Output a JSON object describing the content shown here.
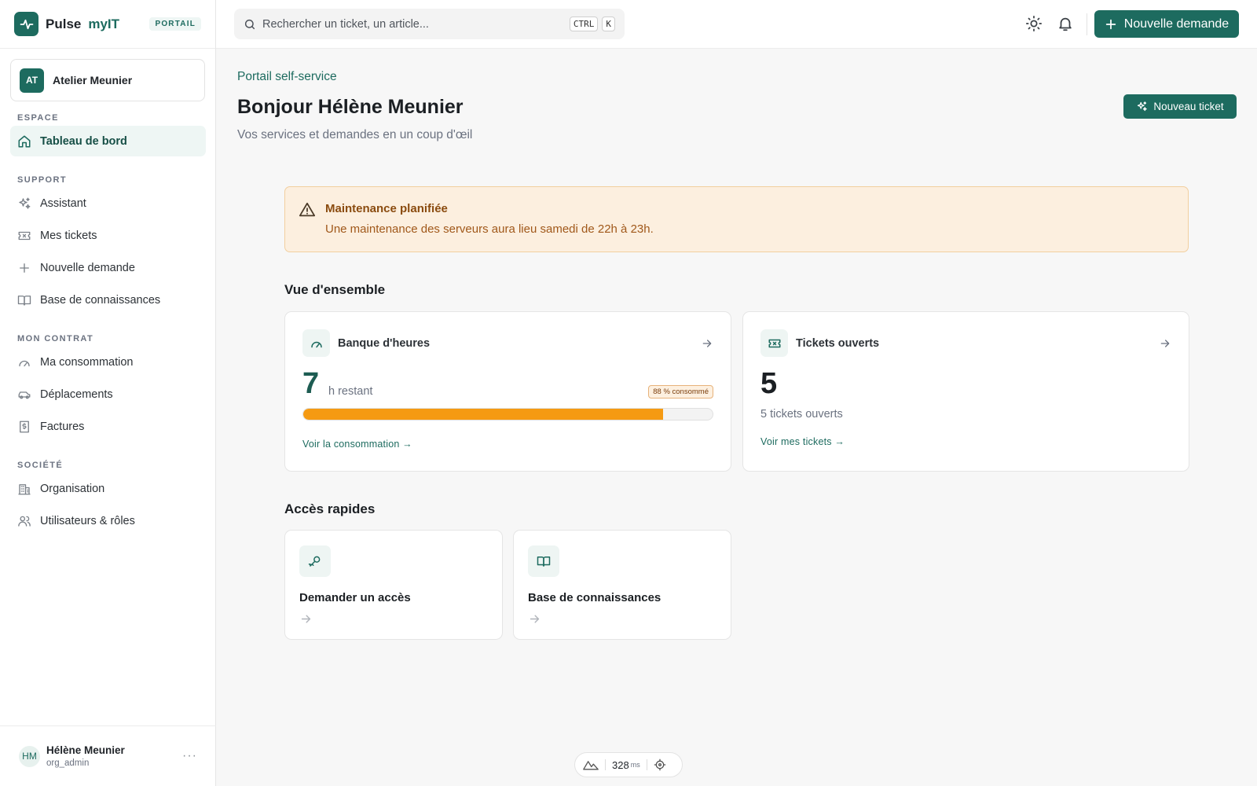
{
  "brand": {
    "name": "Pulse",
    "accent": "myIT",
    "badge": "PORTAIL",
    "color": "#1d6b5f"
  },
  "org": {
    "initials": "AT",
    "name": "Atelier Meunier"
  },
  "nav": {
    "sections": [
      {
        "title": "ESPACE",
        "items": [
          {
            "label": "Tableau de bord",
            "icon": "home-icon",
            "active": true
          }
        ]
      },
      {
        "title": "SUPPORT",
        "items": [
          {
            "label": "Assistant",
            "icon": "sparkles-icon"
          },
          {
            "label": "Mes tickets",
            "icon": "ticket-icon"
          },
          {
            "label": "Nouvelle demande",
            "icon": "plus-icon"
          },
          {
            "label": "Base de connaissances",
            "icon": "book-icon"
          }
        ]
      },
      {
        "title": "MON CONTRAT",
        "items": [
          {
            "label": "Ma consommation",
            "icon": "gauge-icon"
          },
          {
            "label": "Déplacements",
            "icon": "car-icon"
          },
          {
            "label": "Factures",
            "icon": "receipt-icon"
          }
        ]
      },
      {
        "title": "SOCIÉTÉ",
        "items": [
          {
            "label": "Organisation",
            "icon": "building-icon"
          },
          {
            "label": "Utilisateurs & rôles",
            "icon": "users-icon"
          }
        ]
      }
    ]
  },
  "user": {
    "initials": "HM",
    "name": "Hélène Meunier",
    "role": "org_admin",
    "more": "···"
  },
  "topbar": {
    "search_placeholder": "Rechercher un ticket, un article...",
    "shortcut_keys": [
      "CTRL",
      "K"
    ],
    "new_request_label": "Nouvelle demande"
  },
  "header": {
    "eyebrow": "Portail self-service",
    "title": "Bonjour Hélène Meunier",
    "subtitle": "Vos services et demandes en un coup d'œil",
    "new_ticket_label": "Nouveau ticket"
  },
  "alert": {
    "title": "Maintenance planifiée",
    "text": "Une maintenance des serveurs aura lieu samedi de 22h à 23h.",
    "background": "#fcefdf",
    "border": "#f2cf9f"
  },
  "overview": {
    "title": "Vue d'ensemble",
    "hours": {
      "title": "Banque d'heures",
      "value": "7",
      "unit": "h restant",
      "badge": "88 % consommé",
      "consumed_percent": 88,
      "link": "Voir la consommation →",
      "bar_color": "#f59a12"
    },
    "tickets": {
      "title": "Tickets ouverts",
      "value": "5",
      "subtitle": "5 tickets ouverts",
      "link": "Voir mes tickets →"
    }
  },
  "quick_access": {
    "title": "Accès rapides",
    "items": [
      {
        "label": "Demander un accès",
        "icon": "key-icon"
      },
      {
        "label": "Base de connaissances",
        "icon": "book-icon"
      }
    ]
  },
  "perf": {
    "value": "328",
    "unit": "ms"
  }
}
